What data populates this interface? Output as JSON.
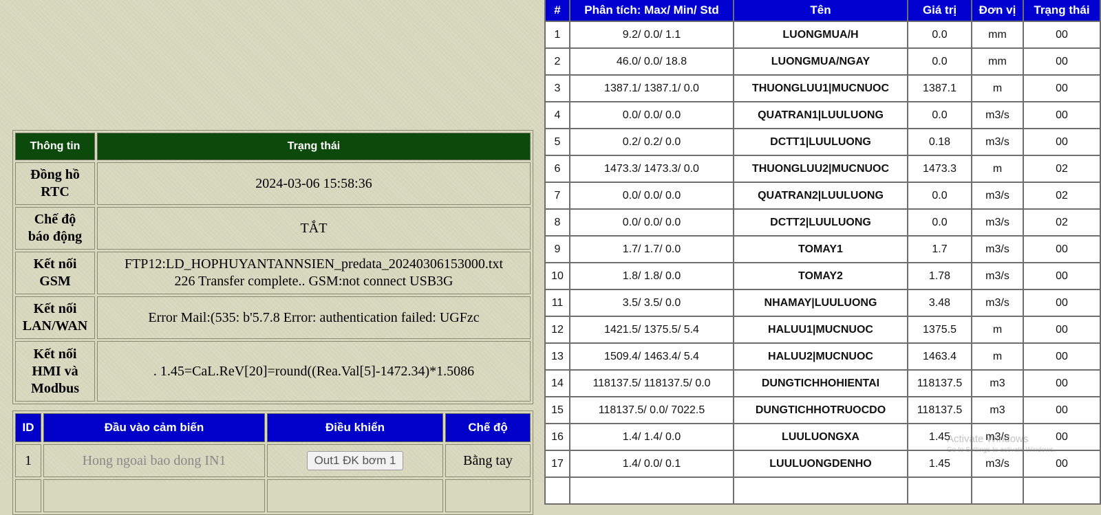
{
  "info": {
    "headers": [
      "Thông tin",
      "Trạng thái"
    ],
    "rows": [
      {
        "label": [
          "Đồng hồ",
          "RTC"
        ],
        "value": [
          "2024-03-06 15:58:36"
        ]
      },
      {
        "label": [
          "Chế độ",
          "báo động"
        ],
        "value": [
          "TẮT"
        ]
      },
      {
        "label": [
          "Kết nối",
          "GSM"
        ],
        "value": [
          "FTP12:LD_HOPHUYANTANNSIEN_predata_20240306153000.txt",
          "226 Transfer complete.. GSM:not connect USB3G"
        ]
      },
      {
        "label": [
          "Kết nối",
          "LAN/WAN"
        ],
        "value": [
          "Error Mail:(535: b'5.7.8 Error: authentication failed: UGFzc"
        ]
      },
      {
        "label": [
          "Kết nối",
          "HMI và",
          "Modbus"
        ],
        "value": [
          ". 1.45=CaL.ReV[20]=round((Rea.Val[5]-1472.34)*1.5086"
        ]
      }
    ]
  },
  "sensors": {
    "headers": [
      "ID",
      "Đầu vào cảm biến",
      "Điều khiển",
      "Chế độ"
    ],
    "rows": [
      {
        "id": "1",
        "input": "Hong ngoai bao dong IN1",
        "control": "Out1 ĐK bơm 1",
        "mode": "Bằng tay"
      }
    ]
  },
  "data_table": {
    "headers": [
      "#",
      "Phân tích: Max/ Min/ Std",
      "Tên",
      "Giá trị",
      "Đơn vị",
      "Trạng thái"
    ],
    "rows": [
      [
        "1",
        "9.2/ 0.0/ 1.1",
        "LUONGMUA/H",
        "0.0",
        "mm",
        "00"
      ],
      [
        "2",
        "46.0/ 0.0/ 18.8",
        "LUONGMUA/NGAY",
        "0.0",
        "mm",
        "00"
      ],
      [
        "3",
        "1387.1/ 1387.1/ 0.0",
        "THUONGLUU1|MUCNUOC",
        "1387.1",
        "m",
        "00"
      ],
      [
        "4",
        "0.0/ 0.0/ 0.0",
        "QUATRAN1|LUULUONG",
        "0.0",
        "m3/s",
        "00"
      ],
      [
        "5",
        "0.2/ 0.2/ 0.0",
        "DCTT1|LUULUONG",
        "0.18",
        "m3/s",
        "00"
      ],
      [
        "6",
        "1473.3/ 1473.3/ 0.0",
        "THUONGLUU2|MUCNUOC",
        "1473.3",
        "m",
        "02"
      ],
      [
        "7",
        "0.0/ 0.0/ 0.0",
        "QUATRAN2|LUULUONG",
        "0.0",
        "m3/s",
        "02"
      ],
      [
        "8",
        "0.0/ 0.0/ 0.0",
        "DCTT2|LUULUONG",
        "0.0",
        "m3/s",
        "02"
      ],
      [
        "9",
        "1.7/ 1.7/ 0.0",
        "TOMAY1",
        "1.7",
        "m3/s",
        "00"
      ],
      [
        "10",
        "1.8/ 1.8/ 0.0",
        "TOMAY2",
        "1.78",
        "m3/s",
        "00"
      ],
      [
        "11",
        "3.5/ 3.5/ 0.0",
        "NHAMAY|LUULUONG",
        "3.48",
        "m3/s",
        "00"
      ],
      [
        "12",
        "1421.5/ 1375.5/ 5.4",
        "HALUU1|MUCNUOC",
        "1375.5",
        "m",
        "00"
      ],
      [
        "13",
        "1509.4/ 1463.4/ 5.4",
        "HALUU2|MUCNUOC",
        "1463.4",
        "m",
        "00"
      ],
      [
        "14",
        "118137.5/ 118137.5/ 0.0",
        "DUNGTICHHOHIENTAI",
        "118137.5",
        "m3",
        "00"
      ],
      [
        "15",
        "118137.5/ 0.0/ 7022.5",
        "DUNGTICHHOTRUOCDO",
        "118137.5",
        "m3",
        "00"
      ],
      [
        "16",
        "1.4/ 1.4/ 0.0",
        "LUULUONGXA",
        "1.45",
        "m3/s",
        "00"
      ],
      [
        "17",
        "1.4/ 0.0/ 0.1",
        "LUULUONGDENHO",
        "1.45",
        "m3/s",
        "00"
      ]
    ]
  },
  "watermark": {
    "line1": "Activate Windows",
    "line2": "Go to Settings to activate Windows."
  },
  "colors": {
    "info_header": "#0c4a0c",
    "table_header": "#0000d0",
    "page_bg": "#d9d9c0"
  }
}
